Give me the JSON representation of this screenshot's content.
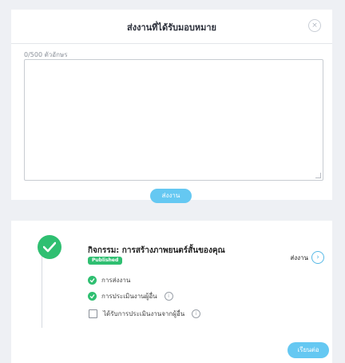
{
  "modal": {
    "title": "ส่งงานที่ได้รับมอบหมาย",
    "close_icon": "×",
    "char_counter": "0/500 ตัวอักษร",
    "submit_label": "ส่งงาน"
  },
  "activity": {
    "title": "กิจกรรม: การสร้างภาพยนตร์สั้นของคุณ",
    "status_badge": "Published",
    "task_link_label": "ส่งงาน",
    "task_link_icon": "›",
    "steps": [
      {
        "label": "การส่งงาน",
        "status": "done"
      },
      {
        "label": "การประเมินงานผู้อื่น",
        "status": "done",
        "info": "i"
      },
      {
        "label": "ได้รับการประเมินงานจากผู้อื่น",
        "status": "pending",
        "info": "i"
      }
    ],
    "next_label": "เรียนต่อ"
  },
  "colors": {
    "accent": "#65c8f2",
    "success": "#2fbf71",
    "background": "#eef0f4"
  }
}
